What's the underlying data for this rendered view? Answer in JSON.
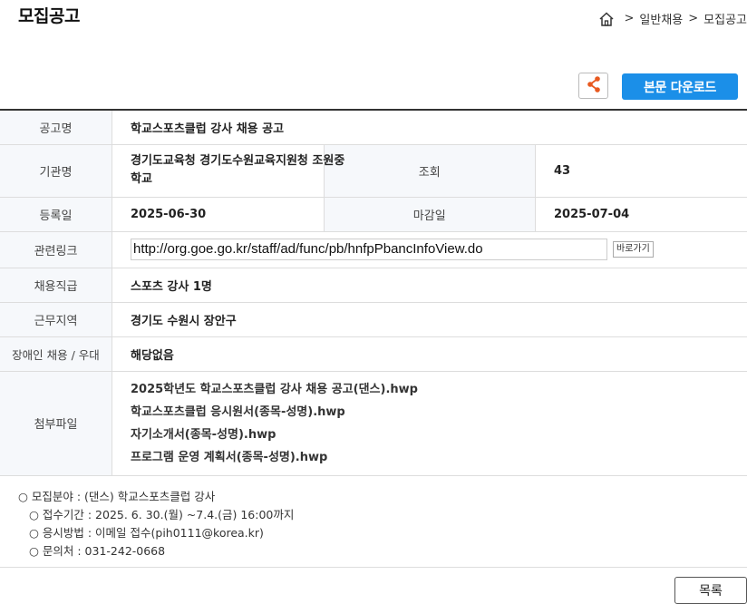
{
  "page": {
    "title": "모집공고"
  },
  "breadcrumb": {
    "sep1": ">",
    "item1": "일반채용",
    "sep2": ">",
    "item2": "모집공고"
  },
  "actions": {
    "download_label": "본문 다운로드"
  },
  "info": {
    "title_label": "공고명",
    "title_value": "학교스포츠클럽 강사 채용 공고",
    "agency_label": "기관명",
    "agency_value": "경기도교육청 경기도수원교육지원청 조원중학교",
    "views_label": "조회",
    "views_value": "43",
    "registered_label": "등록일",
    "registered_value": "2025-06-30",
    "deadline_label": "마감일",
    "deadline_value": "2025-07-04",
    "link_label": "관련링크",
    "link_value": "http://org.goe.go.kr/staff/ad/func/pb/hnfpPbancInfoView.do",
    "link_go_label": "바로가기",
    "position_label": "채용직급",
    "position_value": "스포츠 강사 1명",
    "region_label": "근무지역",
    "region_value": "경기도 수원시 장안구",
    "disability_label": "장애인 채용 / 우대",
    "disability_value": "해당없음",
    "attachments_label": "첨부파일",
    "attachments": [
      "2025학년도 학교스포츠클럽 강사 채용 공고(댄스).hwp",
      "학교스포츠클럽 응시원서(종목-성명).hwp",
      "자기소개서(종목-성명).hwp",
      "프로그램 운영 계획서(종목-성명).hwp"
    ]
  },
  "notes": {
    "line1": "○ 모집분야 : (댄스) 학교스포츠클럽 강사",
    "line2": "○ 접수기간 : 2025. 6. 30.(월) ~7.4.(금) 16:00까지",
    "line3": "○ 응시방법 : 이메일 접수(pih0111@korea.kr)",
    "line4": "○ 문의처 : 031-242-0668"
  },
  "footer": {
    "list_label": "목록"
  },
  "colors": {
    "accent": "#1b8fe8",
    "share_icon": "#e8591f"
  }
}
